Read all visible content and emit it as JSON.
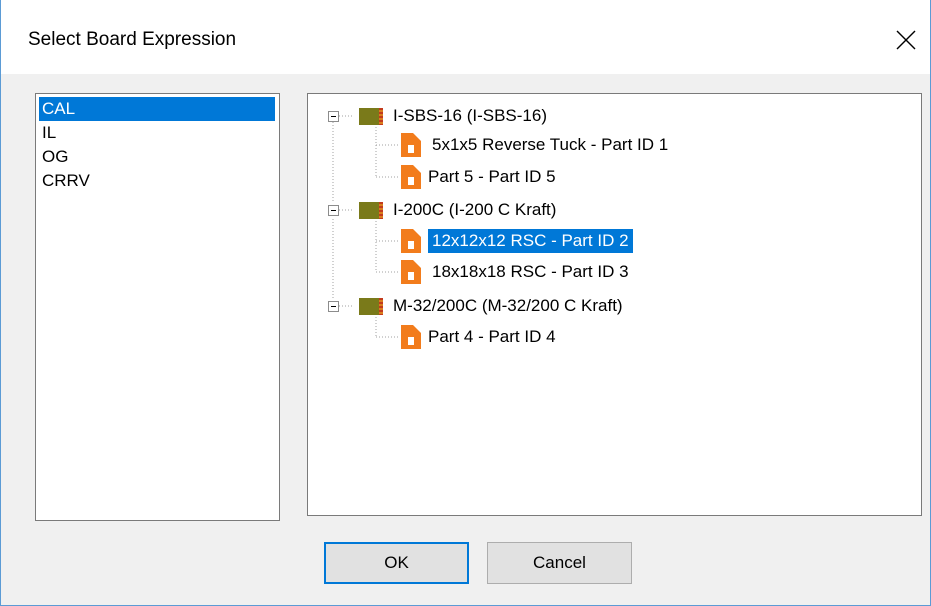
{
  "window": {
    "title": "Select Board Expression"
  },
  "list": {
    "items": [
      "CAL",
      "IL",
      "OG",
      "CRRV"
    ],
    "selected_index": 0
  },
  "tree": {
    "groups": [
      {
        "label": "I-SBS-16 (I-SBS-16)",
        "children": [
          "5x1x5 Reverse Tuck - Part ID 1",
          "Part 5 - Part ID 5"
        ]
      },
      {
        "label": "I-200C (I-200 C Kraft)",
        "children": [
          "12x12x12 RSC - Part ID 2",
          "18x18x18 RSC - Part ID 3"
        ]
      },
      {
        "label": "M-32/200C (M-32/200 C Kraft)",
        "children": [
          "Part 4 - Part ID 4"
        ]
      }
    ],
    "selected": "12x12x12 RSC - Part ID 2"
  },
  "buttons": {
    "ok": "OK",
    "cancel": "Cancel"
  },
  "icons": {
    "close": "close-icon",
    "board": "board-icon",
    "part": "part-icon",
    "collapse": "collapse-icon"
  },
  "colors": {
    "selection": "#0078d7",
    "part_icon": "#f27c1c",
    "board_icon": "#7a7a1a"
  }
}
